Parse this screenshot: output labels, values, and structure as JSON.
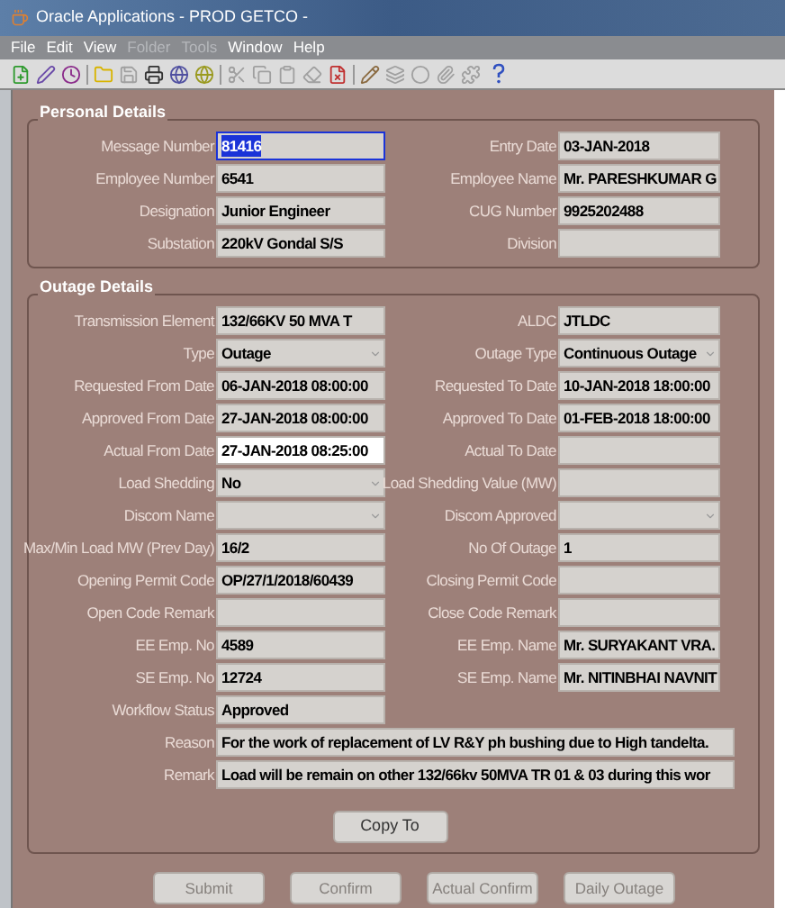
{
  "window": {
    "title": "Oracle Applications - PROD GETCO -"
  },
  "menu": [
    {
      "label": "File",
      "disabled": false
    },
    {
      "label": "Edit",
      "disabled": false
    },
    {
      "label": "View",
      "disabled": false
    },
    {
      "label": "Folder",
      "disabled": true
    },
    {
      "label": "Tools",
      "disabled": true
    },
    {
      "label": "Window",
      "disabled": false
    },
    {
      "label": "Help",
      "disabled": false
    }
  ],
  "personal_details": {
    "title": "Personal Details",
    "rows": [
      [
        {
          "label": "Message Number",
          "value": "81416",
          "kind": "text",
          "focused": false,
          "text_selected": true
        },
        {
          "label": "Entry Date",
          "value": "03-JAN-2018",
          "kind": "text",
          "focused": false,
          "text_selected": false
        }
      ],
      [
        {
          "label": "Employee Number",
          "value": "6541",
          "kind": "text",
          "focused": false,
          "text_selected": false
        },
        {
          "label": "Employee  Name",
          "value": "Mr. PARESHKUMAR G",
          "kind": "text",
          "focused": false,
          "text_selected": false
        }
      ],
      [
        {
          "label": "Designation",
          "value": "Junior Engineer",
          "kind": "text",
          "focused": false,
          "text_selected": false
        },
        {
          "label": "CUG Number",
          "value": "9925202488",
          "kind": "text",
          "focused": false,
          "text_selected": false
        }
      ],
      [
        {
          "label": "Substation",
          "value": "220kV Gondal S/S",
          "kind": "text",
          "focused": false,
          "text_selected": false
        },
        {
          "label": "Division",
          "kind": "text",
          "focused": false,
          "text_selected": false
        }
      ]
    ]
  },
  "outage_details": {
    "title": "Outage Details",
    "rows": [
      [
        {
          "label": "Transmission Element",
          "value": "132/66KV    50 MVA  T",
          "kind": "text",
          "focused": false,
          "text_selected": false
        },
        {
          "label": "ALDC",
          "value": "JTLDC",
          "kind": "text",
          "focused": false,
          "text_selected": false
        }
      ],
      [
        {
          "label": "Type",
          "value": "Outage",
          "kind": "select",
          "focused": false,
          "text_selected": false
        },
        {
          "label": "Outage Type",
          "value": "Continuous Outage",
          "kind": "select",
          "focused": false,
          "text_selected": false
        }
      ],
      [
        {
          "label": "Requested From Date",
          "value": "06-JAN-2018 08:00:00",
          "kind": "text",
          "focused": false,
          "text_selected": false
        },
        {
          "label": "Requested To Date",
          "value": "10-JAN-2018 18:00:00",
          "kind": "text",
          "focused": false,
          "text_selected": false
        }
      ],
      [
        {
          "label": "Approved From Date",
          "value": "27-JAN-2018 08:00:00",
          "kind": "text",
          "focused": false,
          "text_selected": false
        },
        {
          "label": "Approved To Date",
          "value": "01-FEB-2018 18:00:00",
          "kind": "text",
          "focused": false,
          "text_selected": false
        }
      ],
      [
        {
          "label": "Actual From Date",
          "value": "27-JAN-2018 08:25:00",
          "kind": "text",
          "focused": true,
          "text_selected": false
        },
        {
          "label": "Actual To Date",
          "kind": "text",
          "focused": false,
          "text_selected": false
        }
      ],
      [
        {
          "label": "Load Shedding",
          "value": "No",
          "kind": "select",
          "focused": false,
          "text_selected": false
        },
        {
          "label": "Load Shedding Value (MW)",
          "kind": "text",
          "focused": false,
          "text_selected": false
        }
      ],
      [
        {
          "label": "Discom Name",
          "kind": "select",
          "focused": false,
          "text_selected": false
        },
        {
          "label": "Discom Approved",
          "kind": "select",
          "focused": false,
          "text_selected": false
        }
      ],
      [
        {
          "label": "Max/Min Load MW (Prev Day)",
          "value": "16/2",
          "kind": "text",
          "focused": false,
          "text_selected": false
        },
        {
          "label": "No Of Outage",
          "value": "1",
          "kind": "text",
          "focused": false,
          "text_selected": false
        }
      ],
      [
        {
          "label": "Opening Permit Code",
          "value": "OP/27/1/2018/60439",
          "kind": "text",
          "focused": false,
          "text_selected": false
        },
        {
          "label": "Closing Permit Code",
          "kind": "text",
          "focused": false,
          "text_selected": false
        }
      ],
      [
        {
          "label": "Open Code Remark",
          "kind": "text",
          "focused": false,
          "text_selected": false
        },
        {
          "label": "Close Code Remark",
          "kind": "text",
          "focused": false,
          "text_selected": false
        }
      ],
      [
        {
          "label": "EE Emp. No",
          "value": "4589",
          "kind": "text",
          "focused": false,
          "text_selected": false
        },
        {
          "label": "EE Emp. Name",
          "value": "Mr. SURYAKANT VRA.",
          "kind": "text",
          "focused": false,
          "text_selected": false
        }
      ],
      [
        {
          "label": "SE Emp. No",
          "value": "12724",
          "kind": "text",
          "focused": false,
          "text_selected": false
        },
        {
          "label": "SE Emp. Name",
          "value": "Mr. NITINBHAI NAVNIT",
          "kind": "text",
          "focused": false,
          "text_selected": false
        }
      ],
      [
        {
          "label": "Workflow Status",
          "value": "Approved",
          "kind": "text",
          "focused": false,
          "text_selected": false
        }
      ]
    ],
    "wide_rows": [
      {
        "label": "Reason",
        "value": "For the work of replacement of LV R&Y ph bushing due to High tandelta.",
        "kind": "text",
        "focused": false,
        "text_selected": false
      },
      {
        "label": "Remark",
        "value": "Load will be remain on other 132/66kv 50MVA TR 01 & 03 during this wor",
        "kind": "text",
        "focused": false,
        "text_selected": false
      }
    ],
    "copy_button": {
      "label": "Copy To",
      "disabled": false
    }
  },
  "buttons": [
    {
      "label": "Submit",
      "disabled": true
    },
    {
      "label": "Confirm",
      "disabled": true
    },
    {
      "label": "Actual Confirm",
      "disabled": true
    },
    {
      "label": "Daily Outage",
      "disabled": true
    }
  ]
}
